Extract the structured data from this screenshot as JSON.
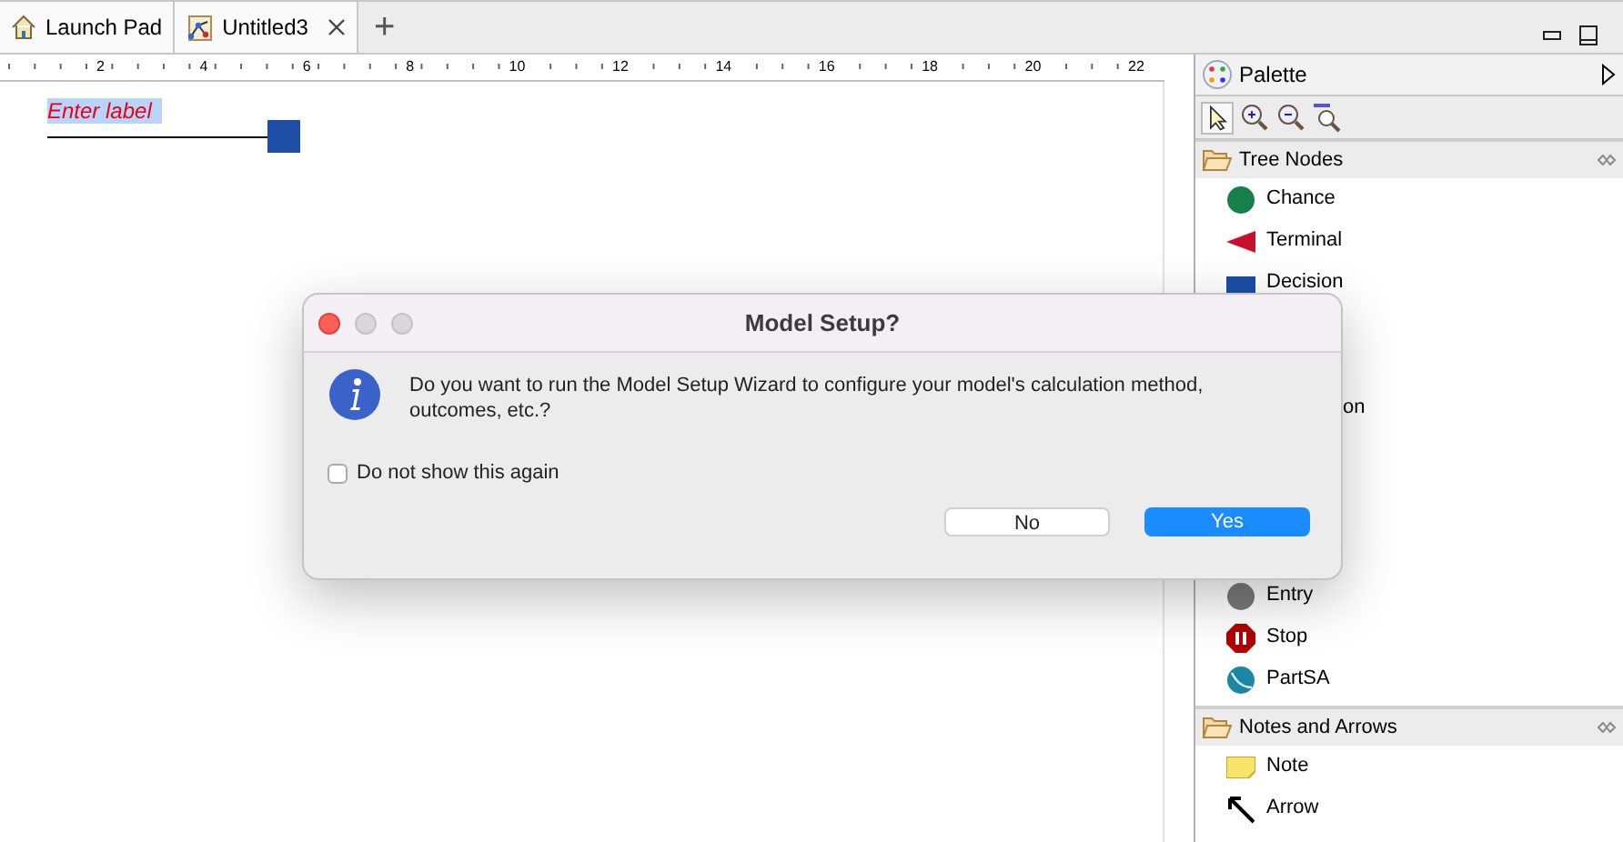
{
  "tabs": [
    {
      "label": "Launch Pad",
      "kind": "home",
      "closable": false
    },
    {
      "label": "Untitled3",
      "kind": "model",
      "closable": true
    }
  ],
  "new_tab_button": "+",
  "ruler": {
    "labels": [
      "2",
      "4",
      "6",
      "8",
      "10",
      "12",
      "14",
      "16",
      "18",
      "20",
      "22"
    ]
  },
  "canvas": {
    "node_label": "Enter label"
  },
  "palette": {
    "title": "Palette",
    "sections": [
      {
        "title": "Tree Nodes",
        "items": [
          {
            "label": "Chance",
            "kind": "chance"
          },
          {
            "label": "Terminal",
            "kind": "terminal"
          },
          {
            "label": "Decision",
            "kind": "decision"
          },
          {
            "label": "on",
            "kind": "partial"
          },
          {
            "label": "Entry",
            "kind": "entry"
          },
          {
            "label": "Stop",
            "kind": "stop"
          },
          {
            "label": "PartSA",
            "kind": "partsa"
          }
        ]
      },
      {
        "title": "Notes and Arrows",
        "items": [
          {
            "label": "Note",
            "kind": "note"
          },
          {
            "label": "Arrow",
            "kind": "arrow"
          }
        ]
      }
    ]
  },
  "dialog": {
    "title": "Model Setup?",
    "message": "Do you want to run the Model Setup Wizard to configure your model's calculation method, outcomes, etc.?",
    "checkbox": {
      "label": "Do not show this again",
      "checked": false
    },
    "buttons": [
      {
        "label": "No",
        "kind": "secondary"
      },
      {
        "label": "Yes",
        "kind": "primary"
      }
    ]
  }
}
